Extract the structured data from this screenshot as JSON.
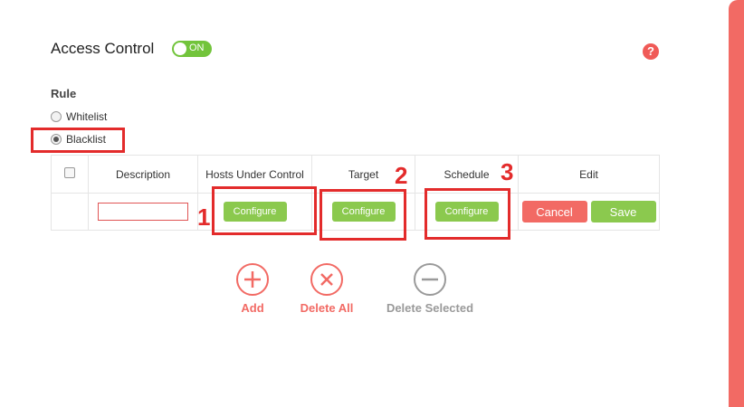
{
  "page": {
    "title": "Access Control",
    "toggle_label": "ON",
    "help_symbol": "?",
    "rule_label": "Rule",
    "radios": [
      {
        "label": "Whitelist",
        "checked": false
      },
      {
        "label": "Blacklist",
        "checked": true
      }
    ]
  },
  "table": {
    "headers": [
      "Description",
      "Hosts Under Control",
      "Target",
      "Schedule",
      "Edit"
    ],
    "row": {
      "description_value": "",
      "hosts_button": "Configure",
      "target_button": "Configure",
      "schedule_button": "Configure",
      "cancel_button": "Cancel",
      "save_button": "Save"
    }
  },
  "annotations": [
    "1",
    "2",
    "3"
  ],
  "actions": [
    {
      "label": "Add",
      "icon": "plus-circle-icon"
    },
    {
      "label": "Delete All",
      "icon": "x-circle-icon"
    },
    {
      "label": "Delete Selected",
      "icon": "minus-circle-icon"
    }
  ],
  "colors": {
    "accent_red": "#f26a64",
    "green": "#8bc94e",
    "toggle_green": "#72c43b",
    "annotation_red": "#e32b2b",
    "disabled_gray": "#9a9a9a"
  }
}
